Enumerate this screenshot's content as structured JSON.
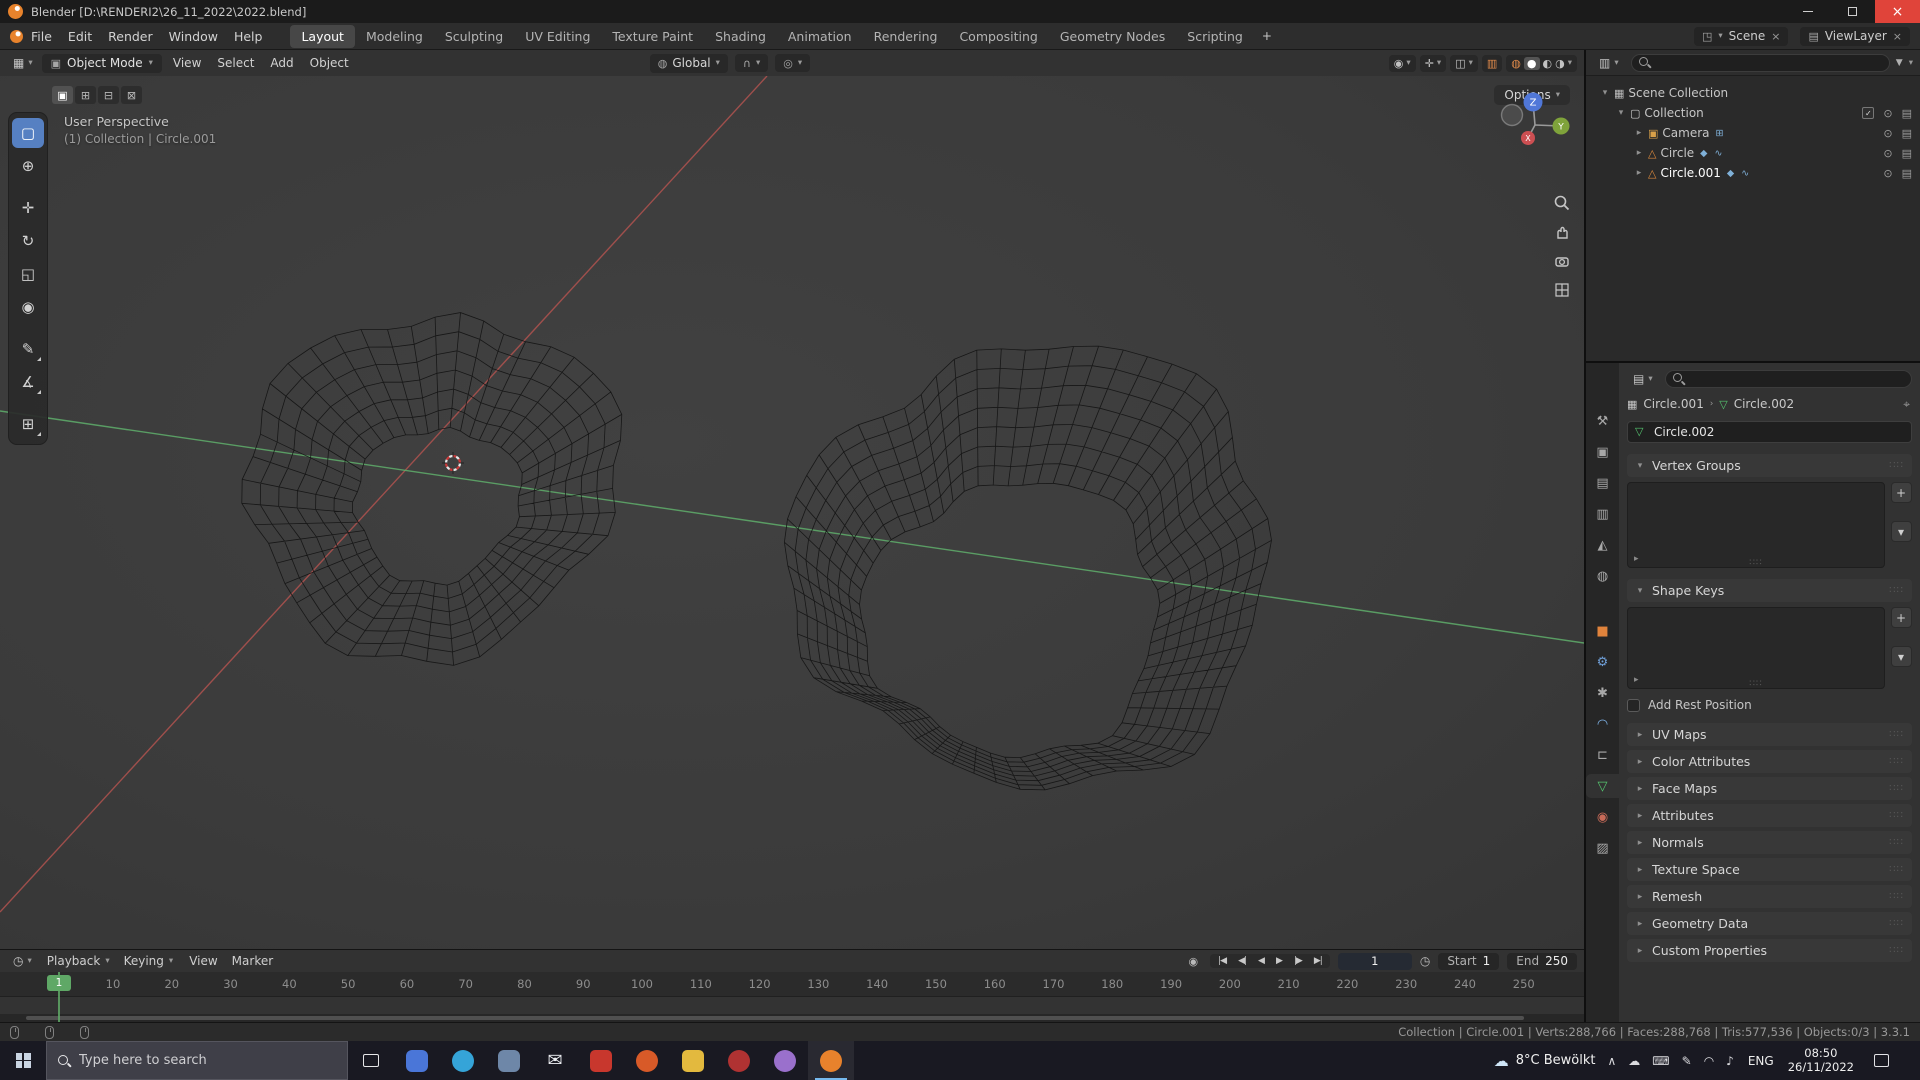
{
  "titlebar": {
    "title": "Blender [D:\\RENDERI2\\26_11_2022\\2022.blend]"
  },
  "icons": {
    "dropdown": "▾",
    "collapsed": "▸",
    "expanded": "▾",
    "plus": "+",
    "close": "×",
    "chev": "›",
    "pin": "⌖",
    "grip": "∷∷",
    "eye": "⊙",
    "screen": "▤",
    "check": "✓",
    "record": "◉",
    "stopwatch": "◷",
    "editor_viewport": "▦",
    "editor_outliner": "▥",
    "editor_props": "▤",
    "editor_timeline": "◷",
    "funnel": "▼",
    "magnet": "∩",
    "proportional": "◎",
    "orientation": "◍",
    "visibility": "◉",
    "gizmo_toggle": "✛",
    "overlay": "◫",
    "xray": "▥",
    "sh_wire": "◍",
    "sh_solid": "●",
    "sh_mat": "◐",
    "sh_rend": "◑",
    "scene_icon": "◳",
    "viewlayer_icon": "▤",
    "scene_collection_icon": "▦",
    "collection_icon": "▢",
    "mesh_data": "▽",
    "object_crumb": "▦",
    "mode_icon": "▣",
    "list_specials": "▸"
  },
  "menubar": {
    "menus": [
      "File",
      "Edit",
      "Render",
      "Window",
      "Help"
    ],
    "workspaces": [
      {
        "label": "Layout",
        "cls": "active"
      },
      {
        "label": "Modeling"
      },
      {
        "label": "Sculpting"
      },
      {
        "label": "UV Editing"
      },
      {
        "label": "Texture Paint"
      },
      {
        "label": "Shading"
      },
      {
        "label": "Animation"
      },
      {
        "label": "Rendering"
      },
      {
        "label": "Compositing"
      },
      {
        "label": "Geometry Nodes"
      },
      {
        "label": "Scripting"
      }
    ],
    "add_workspace_label": "+",
    "scene_label": "Scene",
    "viewlayer_label": "ViewLayer"
  },
  "viewport_header": {
    "mode": "Object Mode",
    "menus": [
      "View",
      "Select",
      "Add",
      "Object"
    ],
    "orientation": "Global",
    "options_label": "Options"
  },
  "viewport": {
    "view_label": "User Perspective",
    "context_label": "(1) Collection | Circle.001",
    "gizmo": {
      "x": "X",
      "y": "Y",
      "z": "Z"
    },
    "select_modes": [
      {
        "dn": "select-mode-set",
        "glyph": "▣",
        "cls": "active"
      },
      {
        "dn": "select-mode-extend",
        "glyph": "⊞"
      },
      {
        "dn": "select-mode-subtract",
        "glyph": "⊟"
      },
      {
        "dn": "select-mode-intersect",
        "glyph": "⊠"
      }
    ],
    "tools": [
      {
        "dn": "tool-tweak-select",
        "glyph": "▢",
        "cls": "active"
      },
      {
        "dn": "tool-cursor",
        "glyph": "⊕"
      },
      {
        "dn": "tool-move",
        "glyph": "✛",
        "cls": "gap"
      },
      {
        "dn": "tool-rotate",
        "glyph": "↻"
      },
      {
        "dn": "tool-scale",
        "glyph": "◱"
      },
      {
        "dn": "tool-transform",
        "glyph": "◉"
      },
      {
        "dn": "tool-annotate",
        "glyph": "✎",
        "cls": "gap grp"
      },
      {
        "dn": "tool-measure",
        "glyph": "∡",
        "cls": "grp"
      },
      {
        "dn": "tool-add-cube",
        "glyph": "⊞",
        "cls": "gap grp"
      }
    ]
  },
  "outliner": {
    "root_label": "Scene Collection",
    "collection_label": "Collection",
    "objects": [
      {
        "dn": "outliner-object-camera",
        "name": "Camera",
        "glyph": "▣",
        "color": "#d9a049",
        "badges": "⊞"
      },
      {
        "dn": "outliner-object-circle",
        "name": "Circle",
        "glyph": "△",
        "color": "#dd8a3d",
        "badges": "◆ ∿"
      },
      {
        "dn": "outliner-object-circle-001",
        "name": "Circle.001",
        "glyph": "△",
        "color": "#dd8a3d",
        "badges": "◆ ∿",
        "cls": "active"
      }
    ]
  },
  "properties": {
    "breadcrumb_object": "Circle.001",
    "breadcrumb_data": "Circle.002",
    "name_value": "Circle.002",
    "vertex_groups_label": "Vertex Groups",
    "shape_keys_label": "Shape Keys",
    "rest_position_label": "Add Rest Position",
    "collapsed_panels": [
      {
        "label": "UV Maps"
      },
      {
        "label": "Color Attributes"
      },
      {
        "label": "Face Maps"
      },
      {
        "label": "Attributes"
      },
      {
        "label": "Normals"
      },
      {
        "label": "Texture Space"
      },
      {
        "label": "Remesh"
      },
      {
        "label": "Geometry Data"
      },
      {
        "label": "Custom Properties"
      }
    ],
    "tabs": [
      {
        "dn": "tab-tool",
        "glyph": "⚒",
        "color": "#a8a8a8"
      },
      {
        "dn": "tab-render",
        "glyph": "▣",
        "color": "#a8a8a8"
      },
      {
        "dn": "tab-output",
        "glyph": "▤",
        "color": "#a8a8a8"
      },
      {
        "dn": "tab-view-layer",
        "glyph": "▥",
        "color": "#a8a8a8"
      },
      {
        "dn": "tab-scene",
        "glyph": "◭",
        "color": "#a8a8a8"
      },
      {
        "dn": "tab-world",
        "glyph": "◍",
        "color": "#a8a8a8"
      },
      {
        "dn": "tab-object",
        "glyph": "■",
        "color": "#e0833c",
        "cls": "gap"
      },
      {
        "dn": "tab-modifiers",
        "glyph": "⚙",
        "color": "#6f9fd8"
      },
      {
        "dn": "tab-particles",
        "glyph": "✱",
        "color": "#a8a8a8"
      },
      {
        "dn": "tab-physics",
        "glyph": "◠",
        "color": "#7fb3e8"
      },
      {
        "dn": "tab-constraints",
        "glyph": "⊏",
        "color": "#a8a8a8"
      },
      {
        "dn": "tab-object-data",
        "glyph": "▽",
        "color": "#55c46f",
        "cls": "active"
      },
      {
        "dn": "tab-material",
        "glyph": "◉",
        "color": "#c86a58"
      },
      {
        "dn": "tab-texture",
        "glyph": "▨",
        "color": "#a8a8a8"
      }
    ]
  },
  "timeline": {
    "menus_dd": [
      "Playback",
      "Keying"
    ],
    "menus_plain": [
      "View",
      "Marker"
    ],
    "transport": [
      {
        "dn": "jump-start-button",
        "glyph": "|◀"
      },
      {
        "dn": "prev-keyframe-button",
        "glyph": "◀|"
      },
      {
        "dn": "play-reverse-button",
        "glyph": "◀"
      },
      {
        "dn": "play-button",
        "glyph": "▶"
      },
      {
        "dn": "next-keyframe-button",
        "glyph": "|▶"
      },
      {
        "dn": "jump-end-button",
        "glyph": "▶|"
      }
    ],
    "current_frame": "1",
    "playhead_frame": "1",
    "start_label": "Start",
    "start_value": "1",
    "end_label": "End",
    "end_value": "250",
    "ticks": [
      "10",
      "20",
      "30",
      "40",
      "50",
      "60",
      "70",
      "80",
      "90",
      "100",
      "110",
      "120",
      "130",
      "140",
      "150",
      "160",
      "170",
      "180",
      "190",
      "200",
      "210",
      "220",
      "230",
      "240",
      "250"
    ]
  },
  "statusbar": {
    "text": "Collection | Circle.001 | Verts:288,766 | Faces:288,768 | Tris:577,536 | Objects:0/3 | 3.3.1"
  },
  "taskbar": {
    "search_placeholder": "Type here to search",
    "apps": [
      {
        "dn": "taskbar-app-chat",
        "color": "#4a76d8",
        "radius": "6px"
      },
      {
        "dn": "taskbar-app-edge",
        "color": "#35a4d8",
        "radius": "50%"
      },
      {
        "dn": "taskbar-app-settings",
        "color": "#6e87a8",
        "radius": "6px"
      },
      {
        "dn": "taskbar-app-mail",
        "color": "transparent",
        "radius": "0px",
        "glyph": "✉"
      },
      {
        "dn": "taskbar-app-adobe",
        "color": "#c8372d",
        "radius": "5px"
      },
      {
        "dn": "taskbar-app-media",
        "color": "#d85a28",
        "radius": "50%"
      },
      {
        "dn": "taskbar-app-file-explorer",
        "color": "#e3b93e",
        "radius": "5px"
      },
      {
        "dn": "taskbar-app-recorder",
        "color": "#b03232",
        "radius": "50%"
      },
      {
        "dn": "taskbar-app-gimp",
        "color": "#9a70cc",
        "radius": "50%"
      },
      {
        "dn": "taskbar-app-blender",
        "color": "#e8822c",
        "radius": "50%",
        "cls": "active"
      }
    ],
    "weather": "8°C Bewölkt",
    "tray": [
      {
        "dn": "tray-expand-icon",
        "glyph": "∧"
      },
      {
        "dn": "tray-onedrive-icon",
        "glyph": "☁"
      },
      {
        "dn": "tray-keyboard-icon",
        "glyph": "⌨"
      },
      {
        "dn": "tray-pen-icon",
        "glyph": "✎"
      },
      {
        "dn": "tray-network-icon",
        "glyph": "◠"
      },
      {
        "dn": "tray-volume-icon",
        "glyph": "♪"
      }
    ],
    "language": "ENG",
    "time": "08:50",
    "date": "26/11/2022"
  }
}
